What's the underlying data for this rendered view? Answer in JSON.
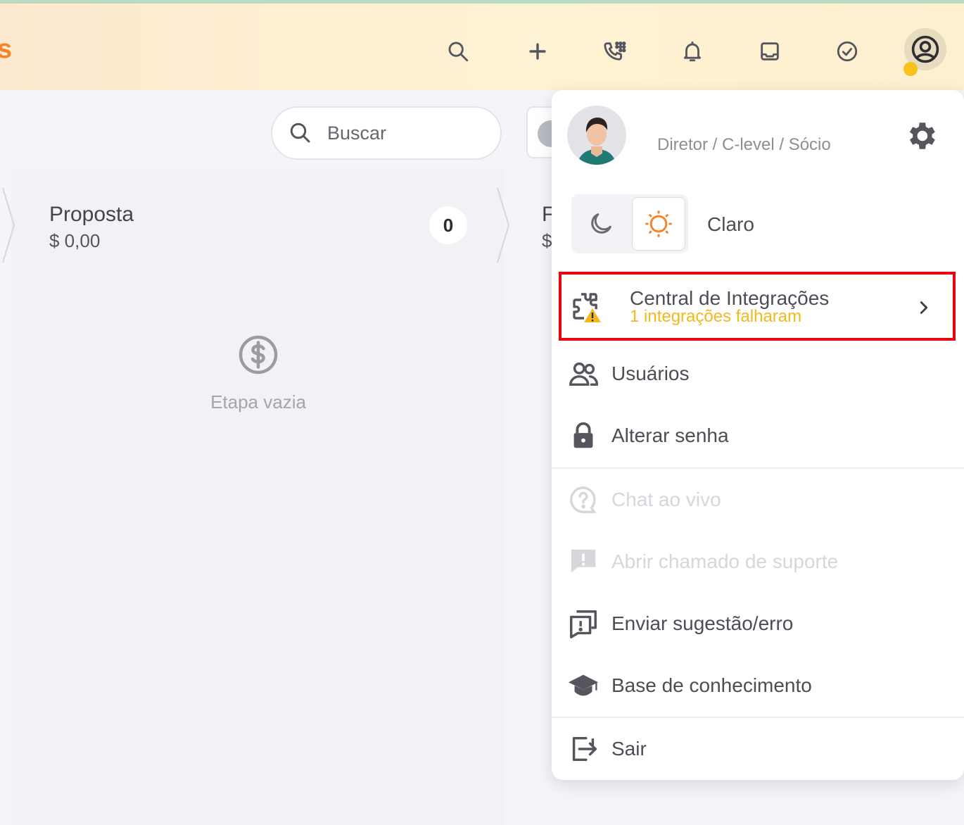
{
  "topbar": {
    "brand_fragment": "s",
    "icons": [
      "search-icon",
      "plus-icon",
      "dialpad-phone-icon",
      "bell-icon",
      "inbox-icon",
      "check-circle-icon",
      "user-circle-icon"
    ]
  },
  "toolbar": {
    "search_placeholder": "Buscar"
  },
  "stage": {
    "title": "Proposta",
    "value": "$ 0,00",
    "count": "0",
    "empty_text": "Etapa vazia"
  },
  "next_stage": {
    "title_fragment": "F",
    "value_fragment": "$"
  },
  "profile_menu": {
    "role": "Diretor / C-level / Sócio",
    "theme": {
      "options": [
        "moon-icon",
        "sun-icon"
      ],
      "selected_label": "Claro"
    },
    "integrations": {
      "title": "Central de Integrações",
      "subtitle": "1 integrações falharam"
    },
    "items": [
      {
        "label": "Usuários",
        "icon": "users-icon",
        "enabled": true
      },
      {
        "label": "Alterar senha",
        "icon": "lock-icon",
        "enabled": true
      },
      {
        "label": "Chat ao vivo",
        "icon": "help-chat-icon",
        "enabled": false
      },
      {
        "label": "Abrir chamado de suporte",
        "icon": "alert-message-icon",
        "enabled": false
      },
      {
        "label": "Enviar sugestão/erro",
        "icon": "feedback-icon",
        "enabled": true
      },
      {
        "label": "Base de conhecimento",
        "icon": "graduation-cap-icon",
        "enabled": true
      },
      {
        "label": "Sair",
        "icon": "logout-icon",
        "enabled": true
      }
    ]
  },
  "colors": {
    "brand_orange": "#f5842a",
    "warning_yellow": "#f5b81c",
    "highlight_red": "#e8050f",
    "status_dot": "#f7c21b"
  }
}
